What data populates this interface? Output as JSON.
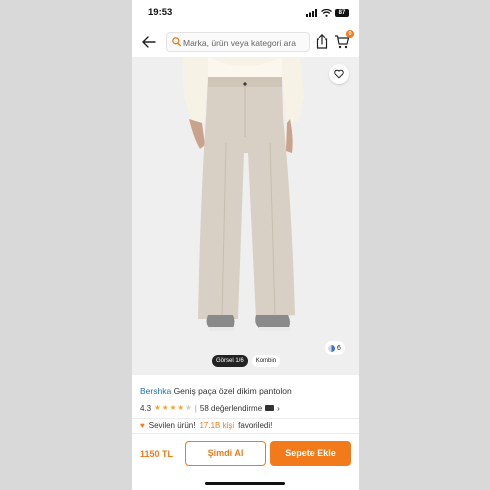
{
  "status_bar": {
    "time": "19:53",
    "battery": "87"
  },
  "search": {
    "placeholder": "Marka, ürün veya kategori ara"
  },
  "cart": {
    "badge_count": "0"
  },
  "image": {
    "tabs": [
      "Görsel 1/6",
      "Kombin"
    ],
    "color_count": "6"
  },
  "product": {
    "brand": "Bershka",
    "name": "Geniş paça özel dikim pantolon",
    "rating": "4.3",
    "rating_value": 4.3,
    "stars_max": 5,
    "reviews": "58 değerlendirme",
    "favorites_prefix": "Sevilen ürün!",
    "favorites_count": "17.1B kişi",
    "favorites_suffix": "favoriledi!"
  },
  "bottom_bar": {
    "price": "1150 TL",
    "buy_now_label": "Şimdi Al",
    "add_to_cart_label": "Sepete Ekle"
  },
  "colors": {
    "accent": "#f27a1a",
    "brand_link": "#1a6fb5",
    "star": "#f5a623"
  },
  "icons": [
    "back-arrow-icon",
    "search-icon",
    "share-icon",
    "cart-icon",
    "heart-icon",
    "camera-icon",
    "chevron-right-icon"
  ]
}
